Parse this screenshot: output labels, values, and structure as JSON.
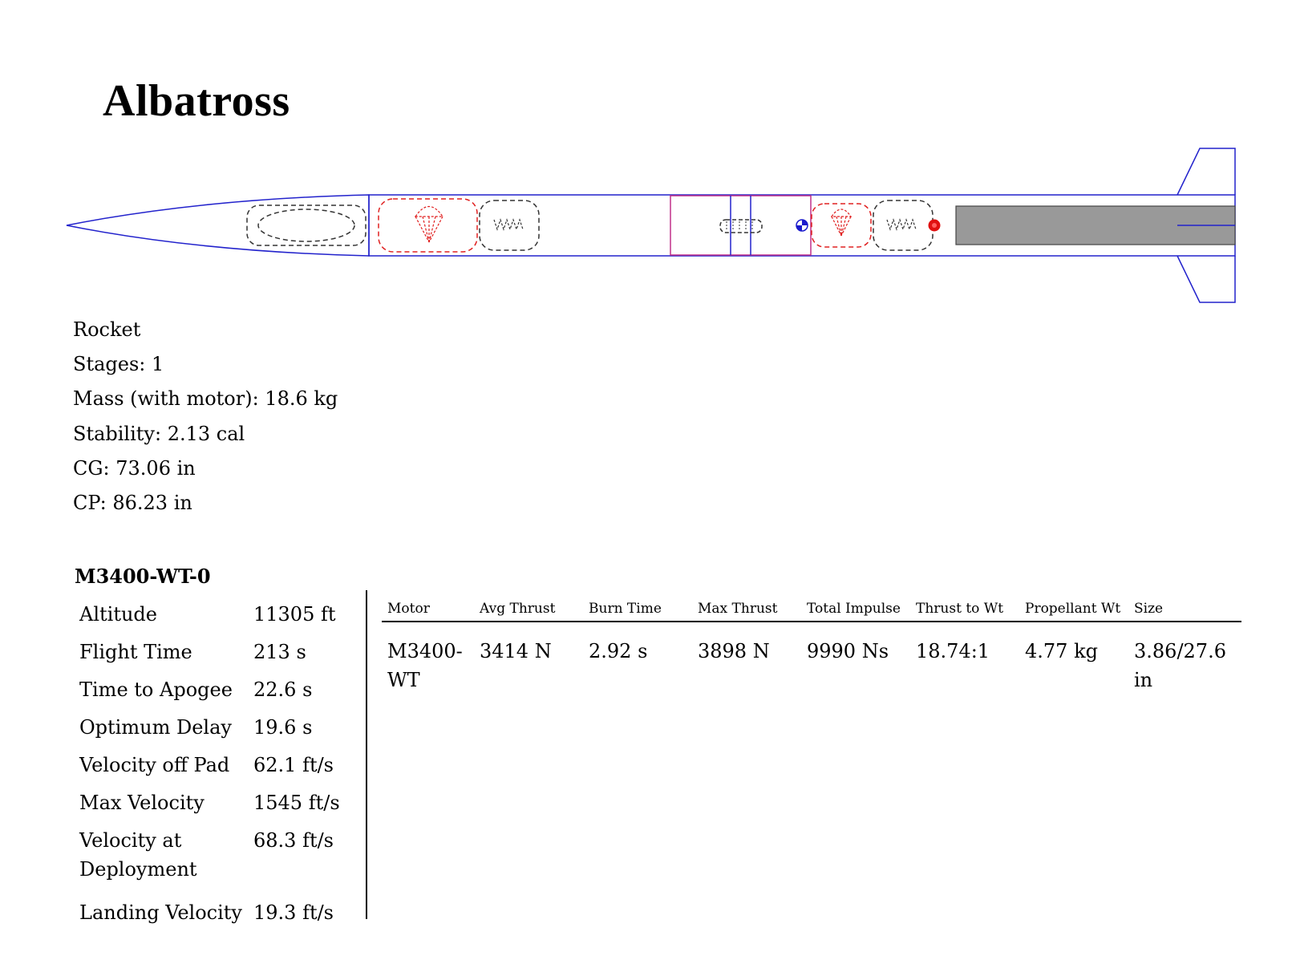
{
  "title": "Albatross",
  "rocket_info": {
    "heading": "Rocket",
    "stages": "Stages: 1",
    "mass": "Mass (with motor): 18.6 kg",
    "stability": "Stability: 2.13 cal",
    "cg": "CG: 73.06 in",
    "cp": "CP: 86.23 in"
  },
  "motor_config": {
    "name": "M3400-WT-0",
    "stats": [
      {
        "label": "Altitude",
        "value": "11305 ft"
      },
      {
        "label": "Flight Time",
        "value": "213 s"
      },
      {
        "label": "Time to Apogee",
        "value": "22.6 s"
      },
      {
        "label": "Optimum Delay",
        "value": "19.6 s"
      },
      {
        "label": "Velocity off Pad",
        "value": "62.1 ft/s"
      },
      {
        "label": "Max Velocity",
        "value": "1545 ft/s"
      },
      {
        "label": "Velocity at Deployment",
        "value": "68.3 ft/s"
      },
      {
        "label": "Landing Velocity",
        "value": "19.3 ft/s"
      }
    ]
  },
  "motor_table": {
    "headers": {
      "motor": "Motor",
      "avg_thrust": "Avg Thrust",
      "burn_time": "Burn Time",
      "max_thrust": "Max Thrust",
      "total_impulse": "Total Impulse",
      "thrust_to_wt": "Thrust to Wt",
      "propellant_wt": "Propellant Wt",
      "size": "Size"
    },
    "row": {
      "motor": "M3400-WT",
      "avg_thrust": "3414 N",
      "burn_time": "2.92 s",
      "max_thrust": "3898 N",
      "total_impulse": "9990 Ns",
      "thrust_to_wt": "18.74:1",
      "propellant_wt": "4.77 kg",
      "size": "3.86/27.6 in"
    }
  },
  "colors": {
    "body_outline": "#2222cc",
    "recovery": "#e02020",
    "component": "#333333",
    "motor_fill": "#999999",
    "coupler": "#c0308a",
    "cp_marker": "#e01010",
    "cg_marker": "#1a1acc"
  }
}
